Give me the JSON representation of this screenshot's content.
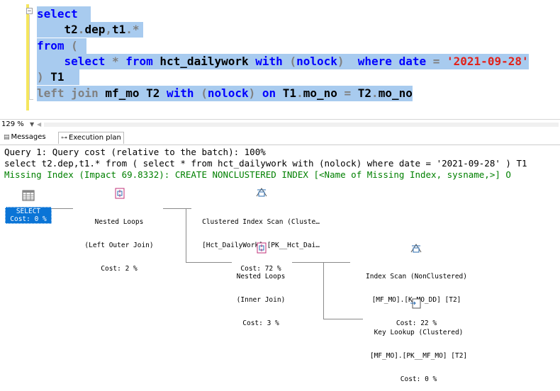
{
  "editor": {
    "lines": [
      [
        {
          "t": "select",
          "c": "kw"
        }
      ],
      [
        {
          "t": "    t2",
          "c": "id"
        },
        {
          "t": ".",
          "c": "gr"
        },
        {
          "t": "dep",
          "c": "id"
        },
        {
          "t": ",",
          "c": "gr"
        },
        {
          "t": "t1",
          "c": "id"
        },
        {
          "t": ".*",
          "c": "gr"
        }
      ],
      [
        {
          "t": "from",
          "c": "kw"
        },
        {
          "t": " (",
          "c": "gr"
        }
      ],
      [
        {
          "t": "    select",
          "c": "kw"
        },
        {
          "t": " * ",
          "c": "gr"
        },
        {
          "t": "from",
          "c": "kw"
        },
        {
          "t": " hct_dailywork ",
          "c": "id"
        },
        {
          "t": "with",
          "c": "kw"
        },
        {
          "t": " (",
          "c": "gr"
        },
        {
          "t": "nolock",
          "c": "kw"
        },
        {
          "t": ")  ",
          "c": "gr"
        },
        {
          "t": "where",
          "c": "kw"
        },
        {
          "t": " date ",
          "c": "kw"
        },
        {
          "t": "=",
          "c": "gr"
        },
        {
          "t": " ",
          "c": "id"
        },
        {
          "t": "'2021-09-28'",
          "c": "st"
        }
      ],
      [
        {
          "t": ")",
          "c": "gr"
        },
        {
          "t": " T1",
          "c": "id"
        }
      ],
      [
        {
          "t": "left join",
          "c": "gr"
        },
        {
          "t": " mf_mo T2 ",
          "c": "id"
        },
        {
          "t": "with",
          "c": "kw"
        },
        {
          "t": " (",
          "c": "gr"
        },
        {
          "t": "nolock",
          "c": "kw"
        },
        {
          "t": ") ",
          "c": "gr"
        },
        {
          "t": "on",
          "c": "kw"
        },
        {
          "t": " T1",
          "c": "id"
        },
        {
          "t": ".",
          "c": "gr"
        },
        {
          "t": "mo_no ",
          "c": "id"
        },
        {
          "t": "=",
          "c": "gr"
        },
        {
          "t": " T2",
          "c": "id"
        },
        {
          "t": ".",
          "c": "gr"
        },
        {
          "t": "mo_no",
          "c": "id"
        }
      ]
    ]
  },
  "statusbar": {
    "zoom": "129 %"
  },
  "tabs": {
    "messages": "Messages",
    "execution_plan": "Execution plan"
  },
  "results": {
    "query_header": "Query 1: Query cost (relative to the batch): 100%",
    "query_text": "select t2.dep,t1.* from ( select * from hct_dailywork with (nolock) where date = '2021-09-28' ) T1",
    "missing_index": "Missing Index (Impact 69.8332): CREATE NONCLUSTERED INDEX [<Name of Missing Index, sysname,>] O"
  },
  "plan": {
    "select": {
      "line1": "SELECT",
      "line2": "Cost: 0 %"
    },
    "nested_loops_1": {
      "line1": "Nested Loops",
      "line2": "(Left Outer Join)",
      "line3": "Cost: 2 %"
    },
    "clustered_scan": {
      "line1": "Clustered Index Scan (Cluste…",
      "line2": "[Hct_DailyWork].[PK__Hct_Dai…",
      "line3": "Cost: 72 %"
    },
    "nested_loops_2": {
      "line1": "Nested Loops",
      "line2": "(Inner Join)",
      "line3": "Cost: 3 %"
    },
    "index_scan": {
      "line1": "Index Scan (NonClustered)",
      "line2": "[MF_MO].[K_MO_DD] [T2]",
      "line3": "Cost: 22 %"
    },
    "key_lookup": {
      "line1": "Key Lookup (Clustered)",
      "line2": "[MF_MO].[PK__MF_MO] [T2]",
      "line3": "Cost: 0 %"
    }
  }
}
